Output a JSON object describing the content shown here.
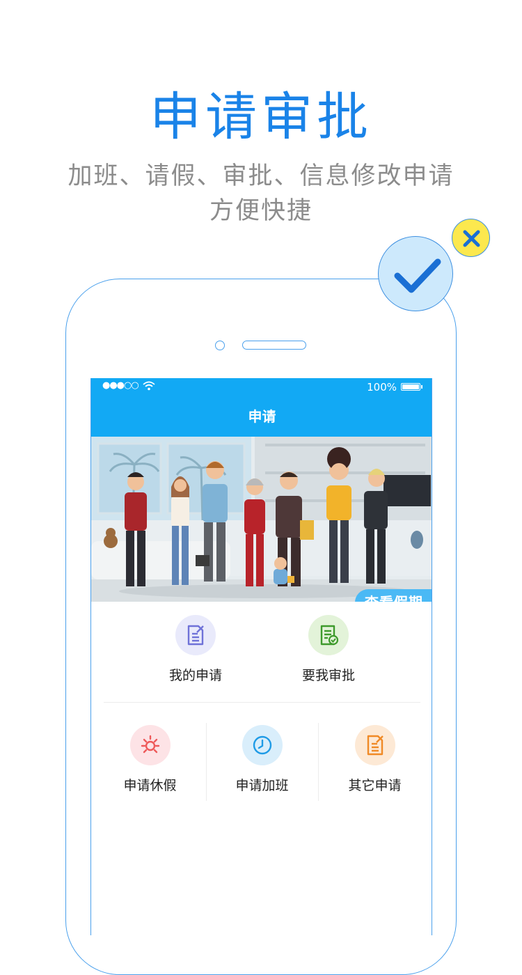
{
  "headline": "申请审批",
  "subline1": "加班、请假、审批、信息修改申请",
  "subline2": "方便快捷",
  "status_bar": {
    "signal": "●●●○○",
    "battery": "100%"
  },
  "nav": {
    "title": "申请"
  },
  "banner": {
    "button_label": "查看假期"
  },
  "grid_top": [
    {
      "label": "我的申请",
      "icon": "document-edit-icon",
      "color": "#6f72d8",
      "bg": "#e9eafb"
    },
    {
      "label": "要我审批",
      "icon": "document-check-icon",
      "color": "#3e9a2c",
      "bg": "#e3f3d9"
    }
  ],
  "grid_bottom": [
    {
      "label": "申请休假",
      "icon": "sun-icon",
      "color": "#ee5a5a",
      "bg": "#fde3e6"
    },
    {
      "label": "申请加班",
      "icon": "clock-icon",
      "color": "#1f9be6",
      "bg": "#d9eefb"
    },
    {
      "label": "其它申请",
      "icon": "document-edit-icon",
      "color": "#f08a26",
      "bg": "#fde9d5"
    }
  ],
  "colors": {
    "accent": "#1a83e8",
    "nav_bg": "#12a9f4",
    "badge_check_bg": "#cde9fc",
    "badge_x_bg": "#fce84e"
  }
}
